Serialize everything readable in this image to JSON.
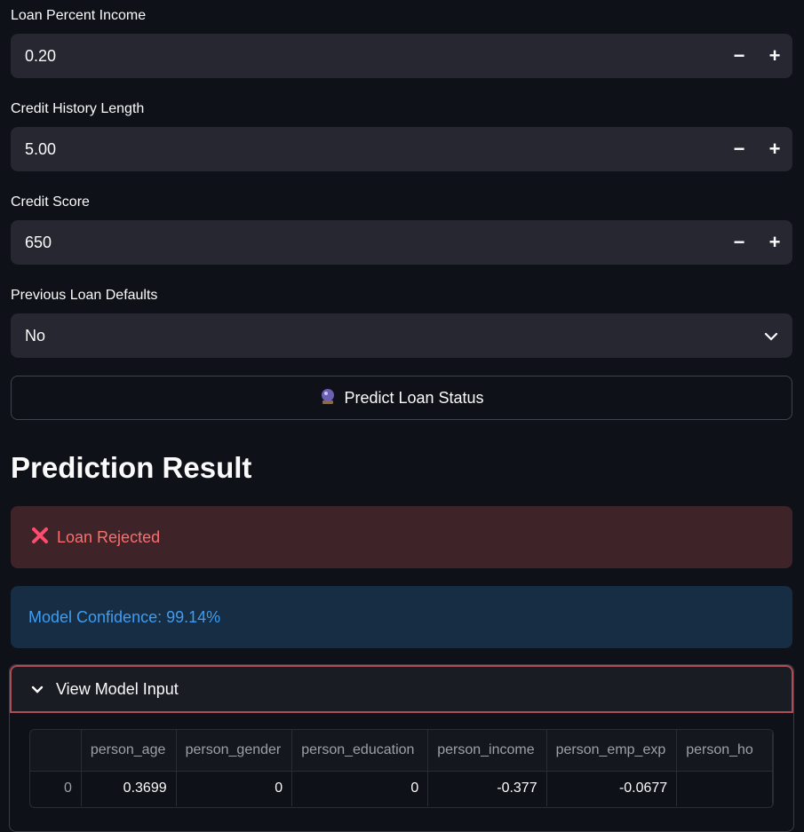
{
  "fields": [
    {
      "label": "Loan Percent Income",
      "value": "0.20"
    },
    {
      "label": "Credit History Length",
      "value": "5.00"
    },
    {
      "label": "Credit Score",
      "value": "650"
    }
  ],
  "stepper": {
    "minus": "−",
    "plus": "+"
  },
  "previous_defaults": {
    "label": "Previous Loan Defaults",
    "value": "No",
    "icon": "chevron-down-icon"
  },
  "predict_button": {
    "icon": "crystal-ball-icon",
    "label": "Predict Loan Status"
  },
  "result": {
    "title": "Prediction Result",
    "status": {
      "icon": "cross-mark-icon",
      "text": "Loan Rejected",
      "color": "#ff6c6c"
    },
    "confidence": "Model Confidence: 99.14%"
  },
  "expander": {
    "label": "View Model Input",
    "table": {
      "columns": [
        "",
        "person_age",
        "person_gender",
        "person_education",
        "person_income",
        "person_emp_exp",
        "person_ho"
      ],
      "rows": [
        [
          "0",
          "0.3699",
          "0",
          "0",
          "-0.377",
          "-0.0677",
          ""
        ]
      ]
    }
  }
}
